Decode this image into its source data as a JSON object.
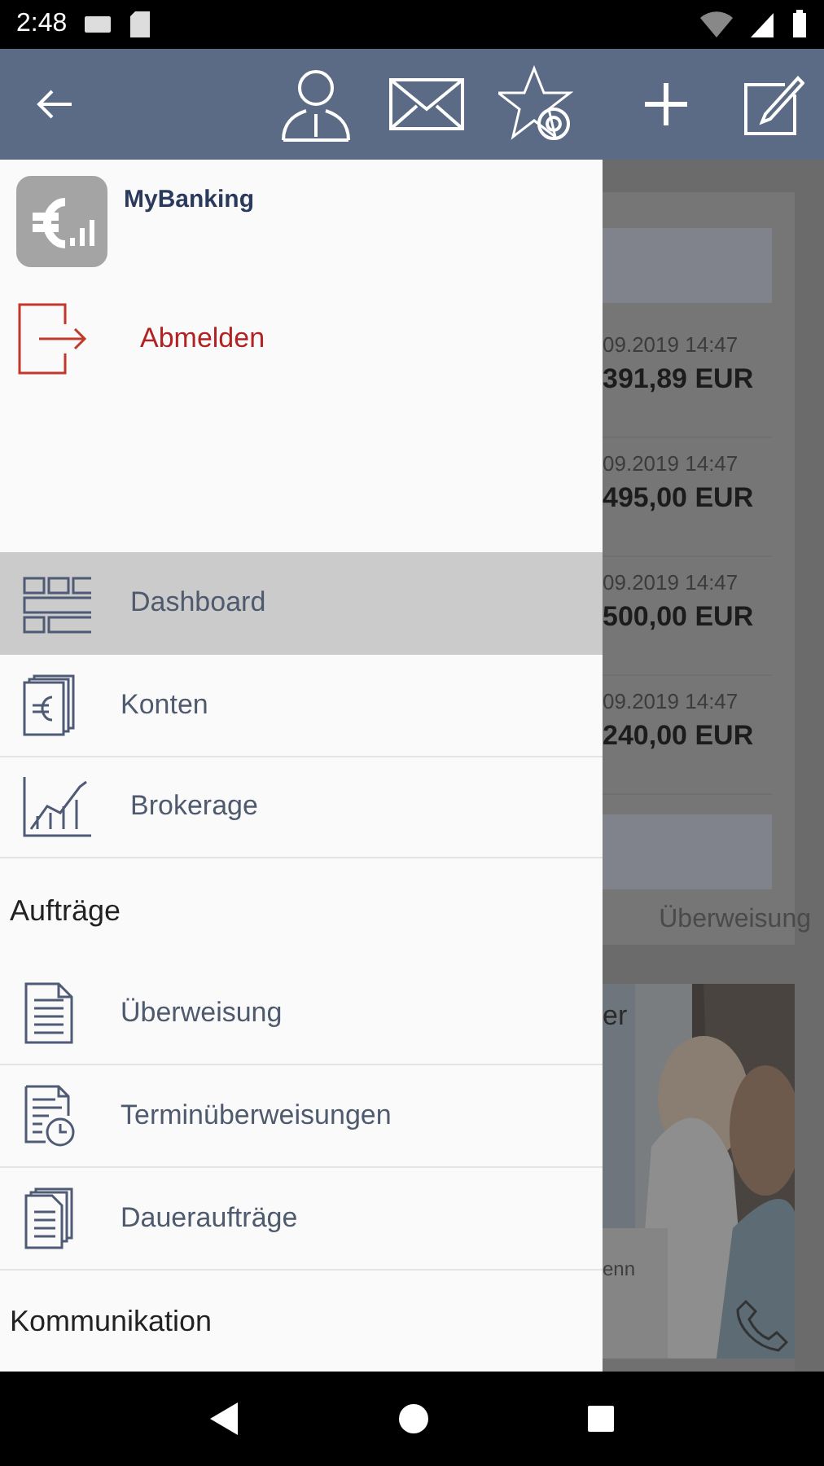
{
  "status_bar": {
    "time": "2:48"
  },
  "drawer": {
    "app_name": "MyBanking",
    "logout": {
      "label": "Abmelden"
    },
    "items": [
      {
        "kind": "entry",
        "label": "Dashboard",
        "selected": true
      },
      {
        "kind": "entry",
        "label": "Konten",
        "selected": false
      },
      {
        "kind": "entry",
        "label": "Brokerage",
        "selected": false
      },
      {
        "kind": "header",
        "label": "Aufträge"
      },
      {
        "kind": "entry",
        "label": "Überweisung",
        "selected": false
      },
      {
        "kind": "entry",
        "label": "Terminüberweisungen",
        "selected": false
      },
      {
        "kind": "entry",
        "label": "Daueraufträge",
        "selected": false
      },
      {
        "kind": "header",
        "label": "Kommunikation"
      }
    ]
  },
  "background": {
    "transactions": [
      {
        "date": "09.2019 14:47",
        "amount": "391,89 EUR"
      },
      {
        "date": "09.2019 14:47",
        "amount": "495,00 EUR"
      },
      {
        "date": "09.2019 14:47",
        "amount": "500,00 EUR"
      },
      {
        "date": "09.2019 14:47",
        "amount": "240,00 EUR"
      }
    ],
    "link": "Überweisung",
    "teaser": {
      "heading": "er",
      "caption": "enn"
    }
  }
}
